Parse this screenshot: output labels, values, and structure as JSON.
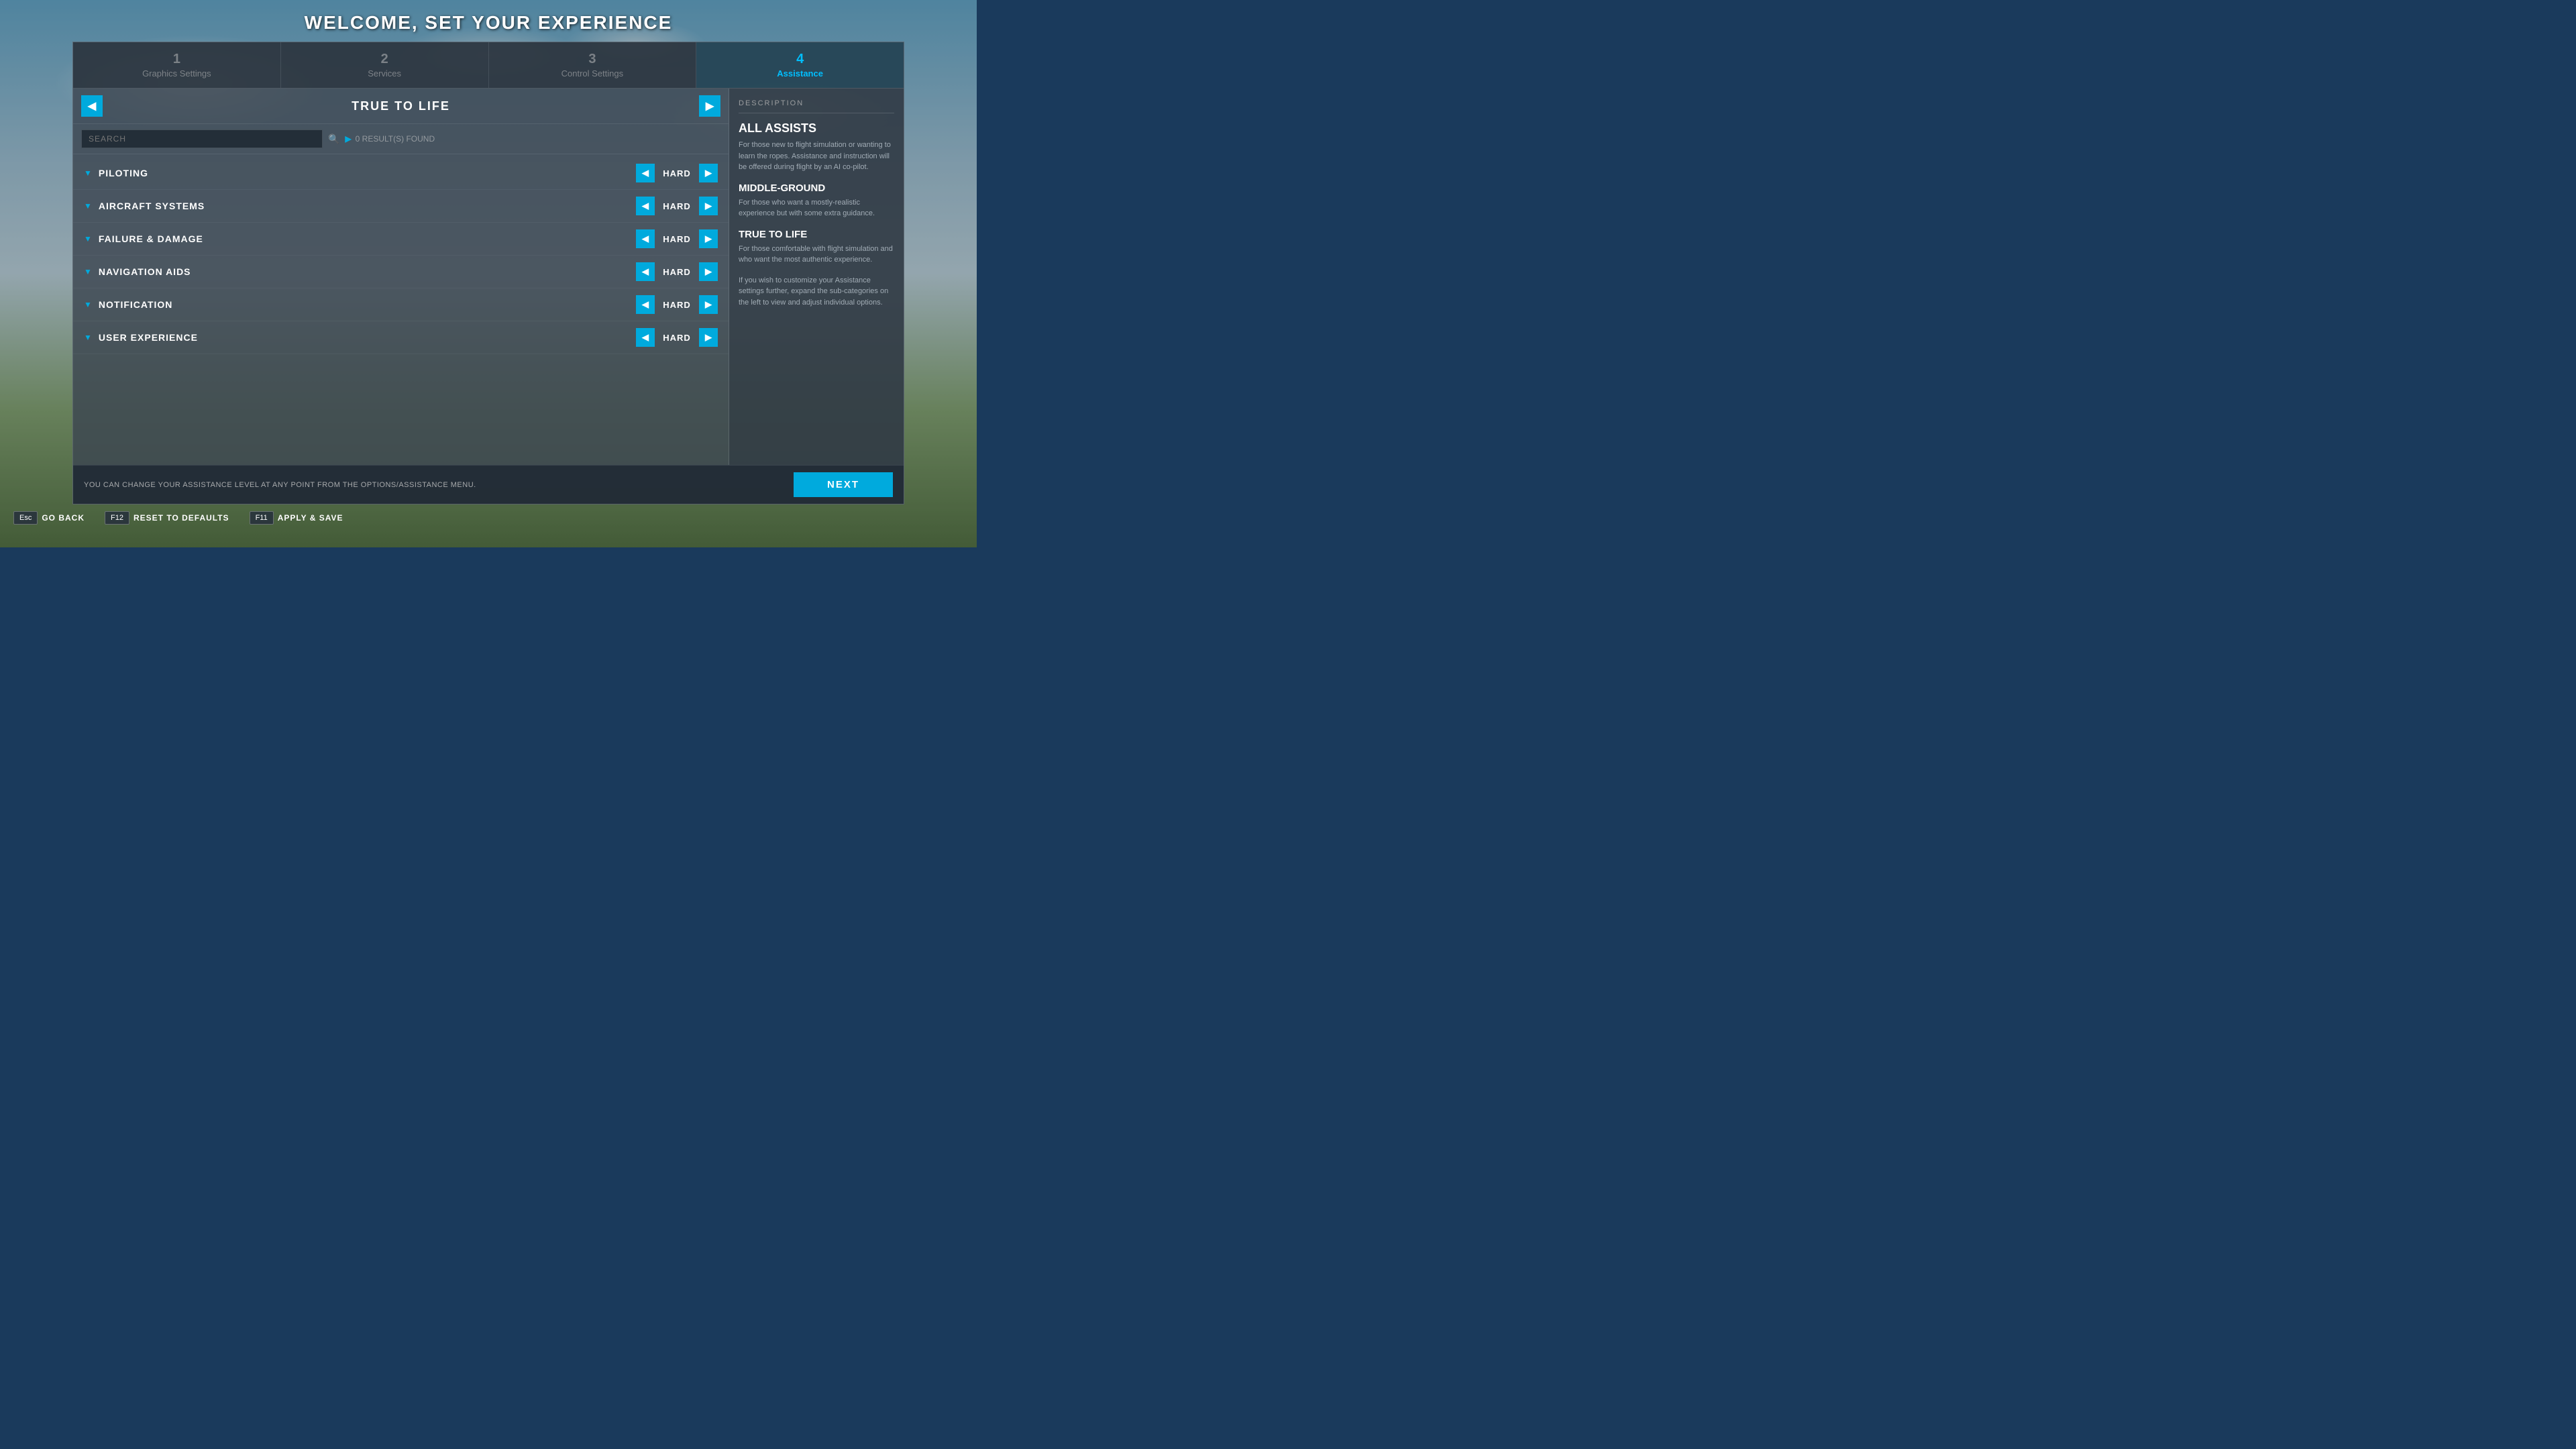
{
  "page": {
    "title": "WELCOME, SET YOUR EXPERIENCE"
  },
  "steps": [
    {
      "id": 1,
      "number": "1",
      "label": "Graphics Settings",
      "active": false
    },
    {
      "id": 2,
      "number": "2",
      "label": "Services",
      "active": false
    },
    {
      "id": 3,
      "number": "3",
      "label": "Control Settings",
      "active": false
    },
    {
      "id": 4,
      "number": "4",
      "label": "Assistance",
      "active": true
    }
  ],
  "mode": {
    "current": "TRUE TO LIFE",
    "prev_label": "◀",
    "next_label": "▶"
  },
  "search": {
    "placeholder": "SEARCH",
    "results": "0 RESULT(S) FOUND"
  },
  "categories": [
    {
      "name": "PILOTING",
      "value": "HARD"
    },
    {
      "name": "AIRCRAFT SYSTEMS",
      "value": "HARD"
    },
    {
      "name": "FAILURE & DAMAGE",
      "value": "HARD"
    },
    {
      "name": "NAVIGATION AIDS",
      "value": "HARD"
    },
    {
      "name": "NOTIFICATION",
      "value": "HARD"
    },
    {
      "name": "USER EXPERIENCE",
      "value": "HARD"
    }
  ],
  "description": {
    "header": "DESCRIPTION",
    "sections": [
      {
        "title": "ALL ASSISTS",
        "text": "For those new to flight simulation or wanting to learn the ropes. Assistance and instruction will be offered during flight by an AI co-pilot."
      },
      {
        "title": "MIDDLE-GROUND",
        "text": "For those who want a mostly-realistic experience but with some extra guidance."
      },
      {
        "title": "TRUE TO LIFE",
        "text": "For those comfortable with flight simulation and who want the most authentic experience."
      },
      {
        "title": "",
        "text": "If you wish to customize your Assistance settings further, expand the sub-categories on the left to view and adjust individual options."
      }
    ]
  },
  "bottom": {
    "info_text": "YOU CAN CHANGE YOUR ASSISTANCE LEVEL AT ANY POINT FROM THE OPTIONS/ASSISTANCE MENU.",
    "next_button": "NEXT"
  },
  "footer": {
    "keys": [
      {
        "key": "Esc",
        "label": "GO BACK"
      },
      {
        "key": "F12",
        "label": "RESET TO DEFAULTS"
      },
      {
        "key": "F11",
        "label": "APPLY & SAVE"
      }
    ]
  }
}
